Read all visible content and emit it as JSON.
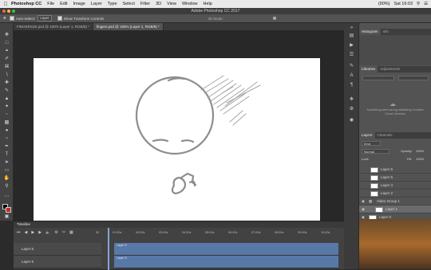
{
  "menubar": {
    "app": "Photoshop CC",
    "items": [
      "File",
      "Edit",
      "Image",
      "Layer",
      "Type",
      "Select",
      "Filter",
      "3D",
      "View",
      "Window",
      "Help"
    ],
    "battery": "(90%)",
    "clock": "Sat 16:03"
  },
  "window_title": "Adobe Photoshop CC 2017",
  "options": {
    "auto_select_label": "Auto-Select:",
    "auto_select_value": "Layer",
    "transform_label": "Show Transform Controls",
    "mode_label": "3D Mode:"
  },
  "doc_tabs": [
    {
      "label": "FINGERS3S.psd @ 100% (Layer 1, RGB/8) *",
      "active": false
    },
    {
      "label": "fingers.psd @ 100% (Layer 1, RGB/8) *",
      "active": true
    }
  ],
  "panels": {
    "histogram_tabs": [
      "Histogram",
      "Info"
    ],
    "libraries_tabs": [
      "Libraries",
      "Adjustments"
    ],
    "libraries_msg": "Something went wrong initializing Creative Cloud Libraries",
    "layers_tabs": [
      "Layers",
      "Channels"
    ],
    "kind_label": "Kind",
    "blend_mode": "Normal",
    "opacity_label": "Opacity:",
    "opacity_value": "100%",
    "lock_label": "Lock:",
    "fill_label": "Fill:",
    "fill_value": "100%"
  },
  "layers": [
    {
      "name": "Layer 6",
      "visible": false,
      "indent": true
    },
    {
      "name": "Layer 5",
      "visible": false,
      "indent": true
    },
    {
      "name": "Layer 4",
      "visible": false,
      "indent": true
    },
    {
      "name": "Layer 2",
      "visible": false,
      "indent": true
    },
    {
      "name": "Video Group 1",
      "visible": true,
      "indent": false
    },
    {
      "name": "Layer 1",
      "visible": true,
      "indent": true,
      "selected": true
    },
    {
      "name": "Layer 0",
      "visible": true,
      "indent": false
    }
  ],
  "timeline": {
    "title": "Timeline",
    "ticks": [
      "00",
      "01:00s",
      "02:00s",
      "03:00s",
      "04:00s",
      "05:00s",
      "06:00s",
      "07:00s",
      "08:00s",
      "09:00s",
      "10:00s"
    ],
    "tracks": [
      {
        "name": "Layer 6",
        "clip": "Layer 6"
      },
      {
        "name": "Layer 5",
        "clip": "Layer 5"
      }
    ]
  }
}
